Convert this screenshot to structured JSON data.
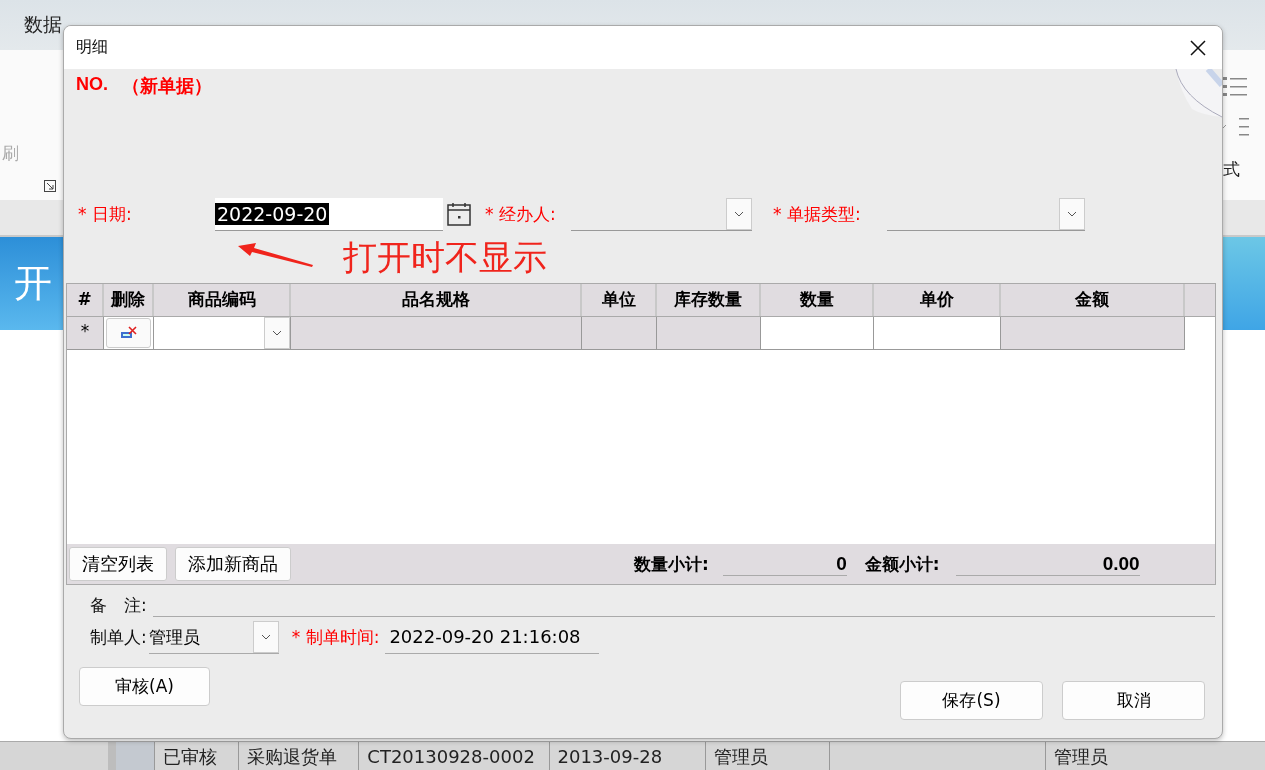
{
  "background": {
    "menu": [
      {
        "label": "数据"
      }
    ],
    "ribbon_left": [
      "刷"
    ],
    "ribbon_right_label": "式",
    "banner": "开",
    "rows": [
      {
        "cells": [
          "已审核",
          "采购退货单",
          "CT20130928-0002",
          "2013-09-28",
          "管理员",
          "",
          "管理员"
        ]
      }
    ]
  },
  "dialog": {
    "title": "明细",
    "number_label": "NO.",
    "status": "（新单据）",
    "fields": [
      {
        "label": "* 日期:",
        "required": true,
        "kind": "date",
        "value": "2022-09-20",
        "selected": true
      },
      {
        "label": "* 经办人:",
        "required": true,
        "kind": "combo"
      },
      {
        "label": "* 单据类型:",
        "required": true,
        "kind": "combo"
      }
    ],
    "annotation": "打开时不显示",
    "grid": {
      "columns": [
        {
          "label": "#",
          "kind": "marker"
        },
        {
          "label": "删除",
          "kind": "delete"
        },
        {
          "label": "商品编码",
          "kind": "combo"
        },
        {
          "label": "品名规格",
          "kind": "readonly"
        },
        {
          "label": "单位",
          "kind": "readonly"
        },
        {
          "label": "库存数量",
          "kind": "readonly"
        },
        {
          "label": "数量",
          "kind": "input"
        },
        {
          "label": "单价",
          "kind": "input"
        },
        {
          "label": "金额",
          "kind": "readonly"
        }
      ],
      "new_row_marker": "*"
    },
    "clear_button": "清空列表",
    "add_button": "添加新商品",
    "qty_total_label": "数量小计:",
    "qty_total": "0",
    "amount_total_label": "金额小计:",
    "amount_total": "0.00",
    "remark_label": "备　注:",
    "maker": {
      "label": "制单人:",
      "required": false,
      "value": "管理员"
    },
    "made_time": {
      "label": "* 制单时间:",
      "required": true,
      "value": "2022-09-20 21:16:08"
    },
    "audit_button": "审核(A)",
    "buttons": [
      "保存(S)",
      "取消"
    ]
  }
}
